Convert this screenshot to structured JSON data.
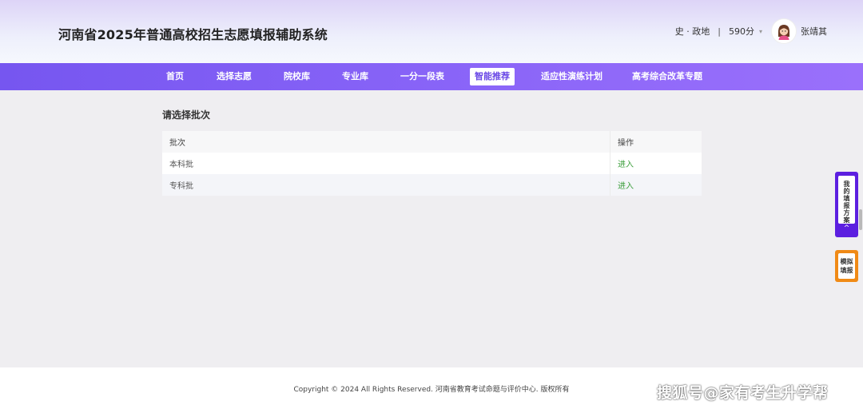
{
  "header": {
    "title": "河南省2025年普通高校招生志愿填报辅助系统",
    "subjects": "史 · 政地",
    "separator": "|",
    "score": "590分",
    "username": "张靖其"
  },
  "nav": {
    "items": [
      "首页",
      "选择志愿",
      "院校库",
      "专业库",
      "一分一段表",
      "智能推荐",
      "适应性演练计划",
      "高考综合改革专题"
    ],
    "active_index": 5
  },
  "main": {
    "section_title": "请选择批次",
    "table": {
      "headers": [
        "批次",
        "操作"
      ],
      "rows": [
        {
          "batch": "本科批",
          "action": "进入"
        },
        {
          "batch": "专科批",
          "action": "进入"
        }
      ]
    }
  },
  "side": {
    "plan_label": "我的填报方案",
    "simulate_label": "模拟填报"
  },
  "footer": {
    "copyright": "Copyright © 2024 All Rights Reserved. 河南省教育考试命题与评价中心. 版权所有"
  },
  "watermark": "搜狐号@家有考生升学帮",
  "colors": {
    "nav_gradient_start": "#7656f0",
    "nav_gradient_end": "#9a70fb",
    "link_green": "#3b9e3b",
    "side_plan_purple": "#5c1fe0",
    "side_sim_orange": "#f08a16"
  }
}
